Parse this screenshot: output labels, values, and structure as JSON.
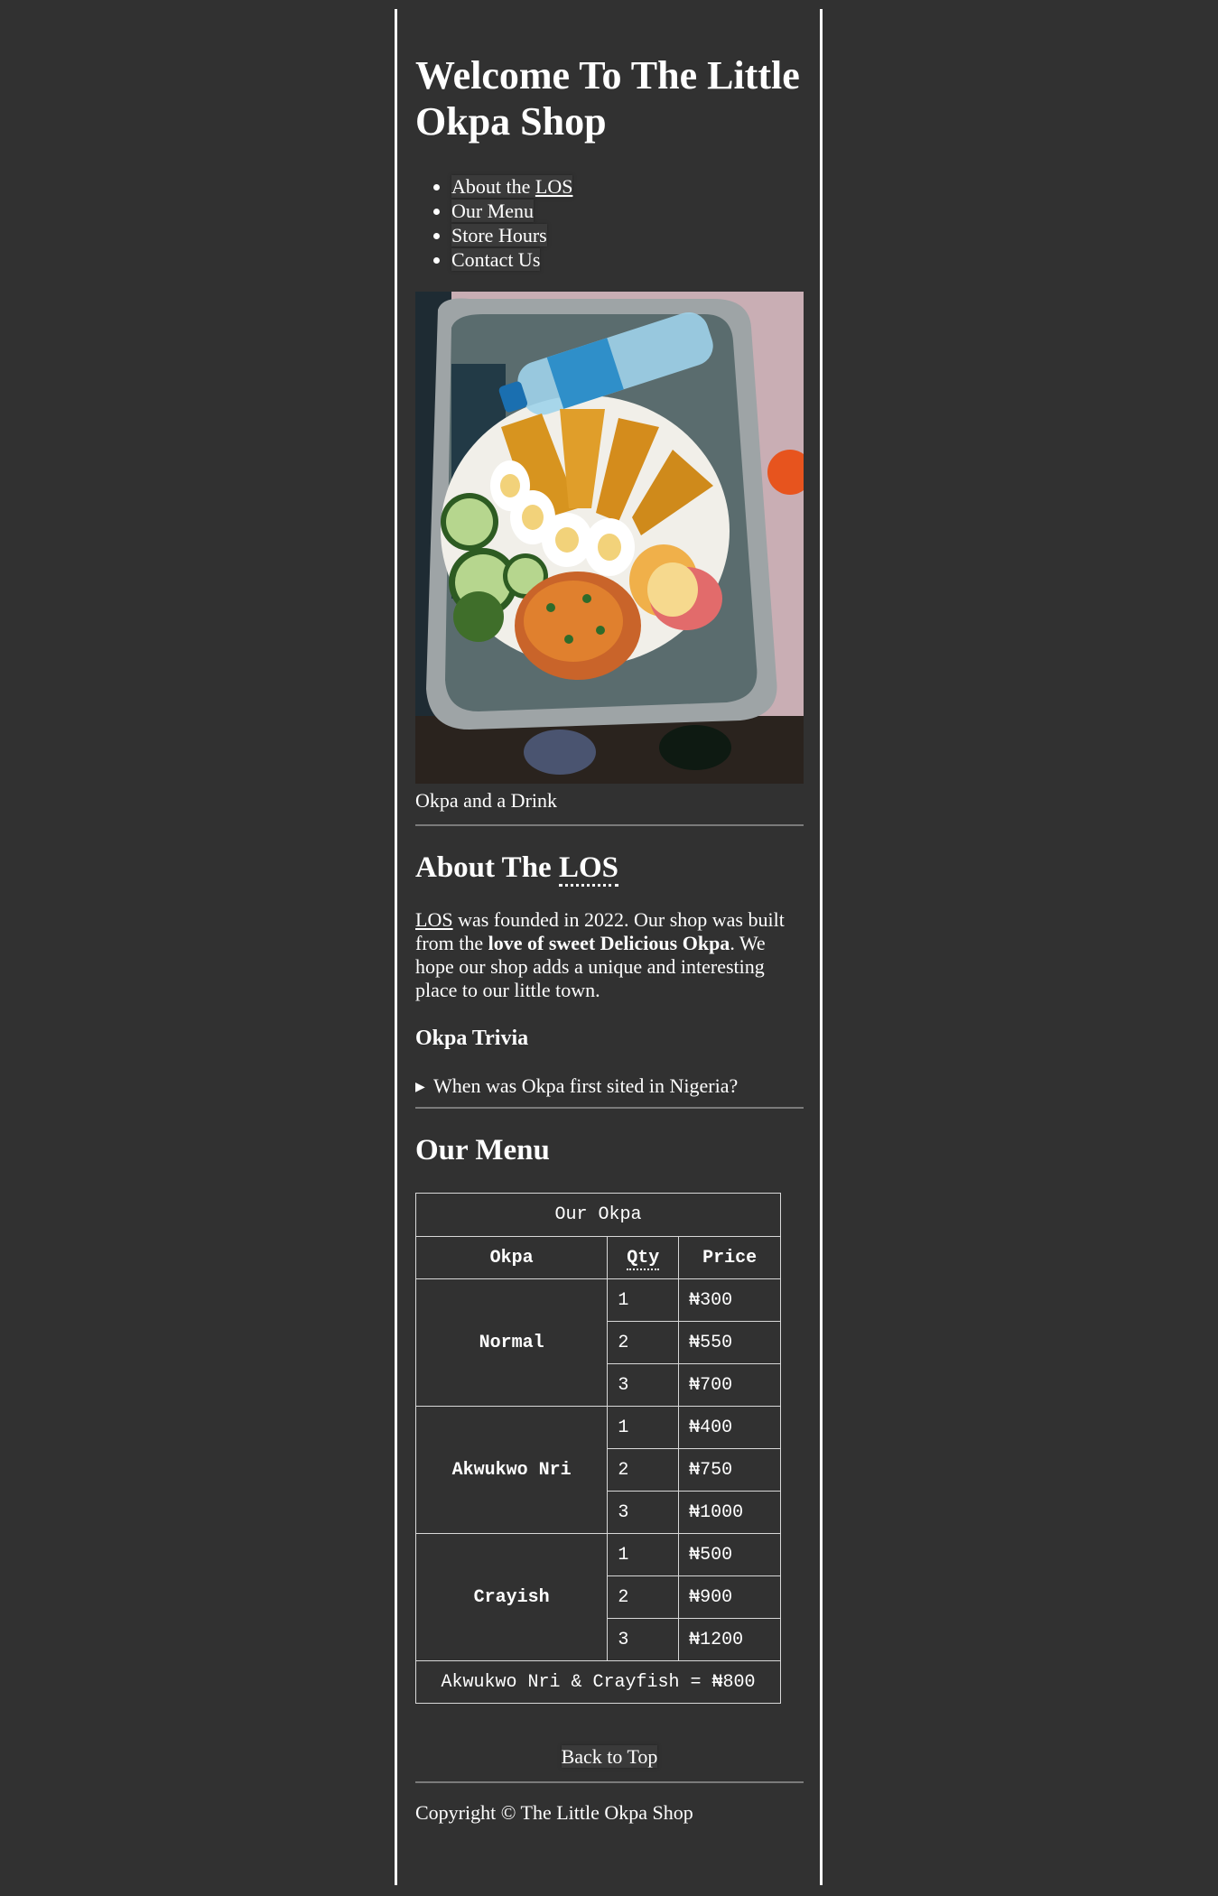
{
  "header": {
    "title": "Welcome To The Little Okpa Shop"
  },
  "nav": {
    "items": [
      {
        "prefix": "About the ",
        "abbr": "LOS"
      },
      {
        "label": "Our Menu"
      },
      {
        "label": "Store Hours"
      },
      {
        "label": "Contact Us"
      }
    ]
  },
  "figure": {
    "image_alt": "Okpa and a Drink",
    "caption": "Okpa and a Drink"
  },
  "about": {
    "heading_prefix": "About The ",
    "heading_abbr": "LOS",
    "paragraph_abbr": "LOS",
    "paragraph_part1": " was founded in 2022. Our shop was built from the ",
    "paragraph_bold": "love of sweet Delicious Okpa",
    "paragraph_part2": ". We hope our shop adds a unique and interesting place to our little town."
  },
  "trivia": {
    "heading": "Okpa Trivia",
    "summary": "When was Okpa first sited in Nigeria?"
  },
  "menu": {
    "heading": "Our Menu",
    "table": {
      "caption": "Our Okpa",
      "headers": {
        "okpa": "Okpa",
        "qty": "Qty",
        "price": "Price"
      },
      "groups": [
        {
          "name": "Normal",
          "rows": [
            {
              "qty": "1",
              "price": "₦300"
            },
            {
              "qty": "2",
              "price": "₦550"
            },
            {
              "qty": "3",
              "price": "₦700"
            }
          ]
        },
        {
          "name": "Akwukwo Nri",
          "rows": [
            {
              "qty": "1",
              "price": "₦400"
            },
            {
              "qty": "2",
              "price": "₦750"
            },
            {
              "qty": "3",
              "price": "₦1000"
            }
          ]
        },
        {
          "name": "Crayish",
          "rows": [
            {
              "qty": "1",
              "price": "₦500"
            },
            {
              "qty": "2",
              "price": "₦900"
            },
            {
              "qty": "3",
              "price": "₦1200"
            }
          ]
        }
      ],
      "footer": "Akwukwo Nri & Crayfish = ₦800"
    }
  },
  "back_to_top": "Back to Top",
  "footer": {
    "copyright": "Copyright © The Little Okpa Shop"
  },
  "colors": {
    "background": "#313131",
    "text": "#ffffff",
    "rule": "#7a7a7a"
  }
}
